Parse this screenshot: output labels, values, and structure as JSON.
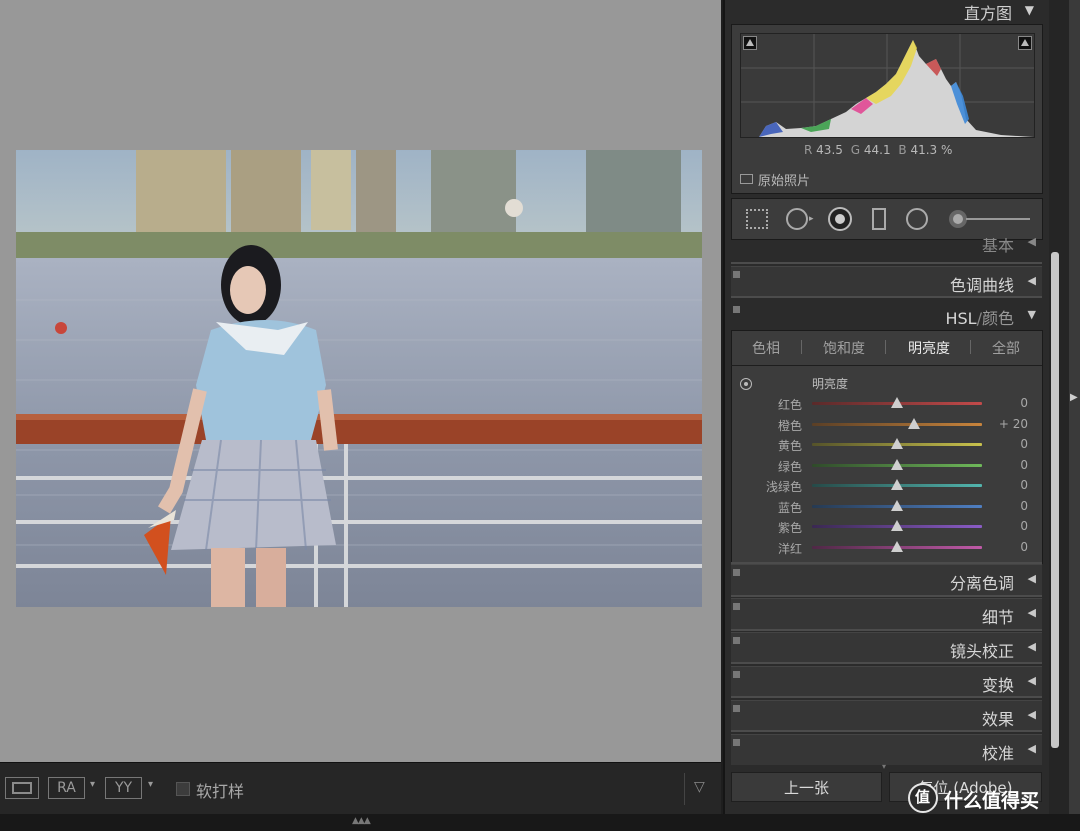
{
  "histogram": {
    "title": "直方图",
    "readout": {
      "r_label": "R",
      "r_value": "43.5",
      "g_label": "G",
      "g_value": "44.1",
      "b_label": "B",
      "b_value": "41.3",
      "unit": "%"
    },
    "original_photo_label": "原始照片"
  },
  "panels": {
    "basic": "基本",
    "tone_curve": "色调曲线",
    "hsl_title": "HSL",
    "hsl_sep": "/",
    "color_title": "颜色",
    "split_toning": "分离色调",
    "detail": "细节",
    "lens": "镜头校正",
    "transform": "变换",
    "effects": "效果",
    "calibration": "校准"
  },
  "hsl": {
    "tabs": [
      "色相",
      "饱和度",
      "明亮度",
      "全部"
    ],
    "active_tab": "明亮度",
    "section_label": "明亮度",
    "rows": [
      {
        "name": "红色",
        "value": "0",
        "level": 0,
        "track_from": "#5a2a2a",
        "track_to": "#c24a4a"
      },
      {
        "name": "橙色",
        "value": "+ 20",
        "level": 20,
        "track_from": "#5a3f26",
        "track_to": "#c8843c"
      },
      {
        "name": "黄色",
        "value": "0",
        "level": 0,
        "track_from": "#55532a",
        "track_to": "#c9c24d"
      },
      {
        "name": "绿色",
        "value": "0",
        "level": 0,
        "track_from": "#2f4a2a",
        "track_to": "#6fb95a"
      },
      {
        "name": "浅绿色",
        "value": "0",
        "level": 0,
        "track_from": "#264a48",
        "track_to": "#52b5ae"
      },
      {
        "name": "蓝色",
        "value": "0",
        "level": 0,
        "track_from": "#263a52",
        "track_to": "#4f7fc2"
      },
      {
        "name": "紫色",
        "value": "0",
        "level": 0,
        "track_from": "#3a2852",
        "track_to": "#8a5cc6"
      },
      {
        "name": "洋红",
        "value": "0",
        "level": 0,
        "track_from": "#4f2846",
        "track_to": "#c05aa8"
      }
    ]
  },
  "toolbar": {
    "ra_label": "RA",
    "yy_label": "YY",
    "soft_proof_label": "软打样"
  },
  "buttons": {
    "prev": "上一张",
    "reset": "复位 (Adobe)"
  },
  "watermark": "值 什么值得买"
}
